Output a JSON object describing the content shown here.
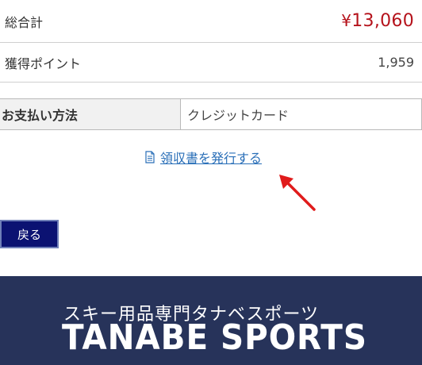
{
  "summary": {
    "total_label": "総合計",
    "total_currency": "¥",
    "total_value": "13,060",
    "points_label": "獲得ポイント",
    "points_value": "1,959"
  },
  "payment": {
    "header": "お支払い方法",
    "value": "クレジットカード"
  },
  "receipt": {
    "link_label": "領収書を発行する",
    "icon": "document-icon"
  },
  "actions": {
    "back_label": "戻る"
  },
  "footer": {
    "tagline": "スキー用品専門タナベスポーツ",
    "logo_text": "TANABE SPORTS"
  },
  "colors": {
    "total_red": "#b5121b",
    "link_blue": "#2a6fb8",
    "back_button": "#0b1272",
    "footer_bg": "#27335a",
    "annotation_arrow": "#e01b1b"
  }
}
